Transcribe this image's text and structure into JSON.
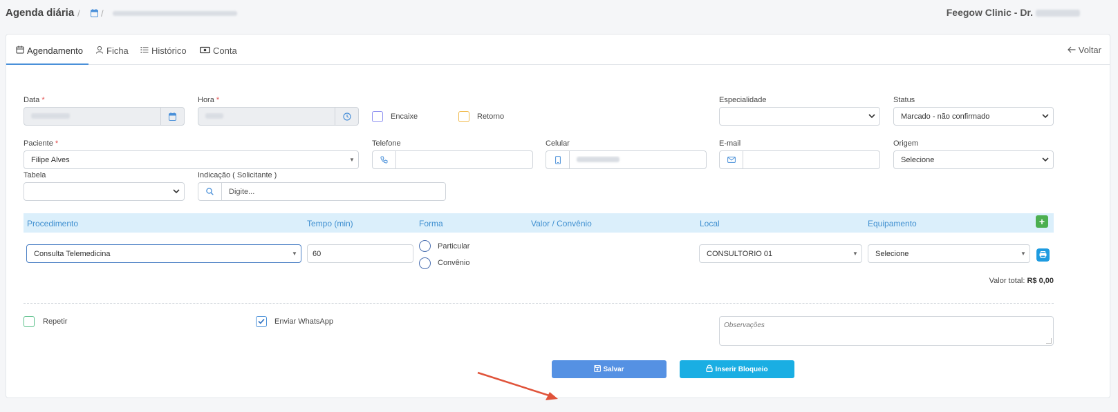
{
  "header": {
    "title": "Agenda diária",
    "breadcrumb_sep1": "/",
    "breadcrumb_sep2": "/",
    "clinic": "Feegow Clinic - Dr."
  },
  "tabs": [
    {
      "label": "Agendamento",
      "icon": "calendar-icon"
    },
    {
      "label": "Ficha",
      "icon": "user-icon"
    },
    {
      "label": "Histórico",
      "icon": "list-icon"
    },
    {
      "label": "Conta",
      "icon": "money-icon"
    }
  ],
  "back_label": "Voltar",
  "form": {
    "data_label": "Data",
    "hora_label": "Hora",
    "required_mark": "*",
    "encaixe_label": "Encaixe",
    "retorno_label": "Retorno",
    "especialidade_label": "Especialidade",
    "especialidade_value": "",
    "status_label": "Status",
    "status_value": "Marcado - não confirmado",
    "paciente_label": "Paciente",
    "paciente_value": "Filipe Alves",
    "telefone_label": "Telefone",
    "telefone_value": "",
    "celular_label": "Celular",
    "email_label": "E-mail",
    "email_value": "",
    "origem_label": "Origem",
    "origem_value": "Selecione",
    "tabela_label": "Tabela",
    "tabela_value": "",
    "indicacao_label": "Indicação ( Solicitante )",
    "indicacao_placeholder": "Digite..."
  },
  "procedures": {
    "headers": {
      "procedimento": "Procedimento",
      "tempo": "Tempo (min)",
      "forma": "Forma",
      "valor": "Valor / Convênio",
      "local": "Local",
      "equipamento": "Equipamento"
    },
    "row": {
      "procedimento": "Consulta Telemedicina",
      "tempo": "60",
      "forma_options": [
        "Particular",
        "Convênio"
      ],
      "local": "CONSULTÓRIO 01",
      "equipamento": "Selecione"
    },
    "total_label": "Valor total:",
    "total_value": "R$ 0,00"
  },
  "options": {
    "repetir_label": "Repetir",
    "repetir_checked": false,
    "whatsapp_label": "Enviar WhatsApp",
    "whatsapp_checked": true,
    "observacoes_placeholder": "Observações"
  },
  "buttons": {
    "save": "Salvar",
    "block": "Inserir Bloqueio"
  },
  "colors": {
    "accent": "#4a90d9",
    "save_button": "#5591e3",
    "block_button": "#1aaee3",
    "add_button": "#4caf50",
    "table_header_bg": "#dbeffb",
    "annotation_arrow": "#e0533a"
  }
}
